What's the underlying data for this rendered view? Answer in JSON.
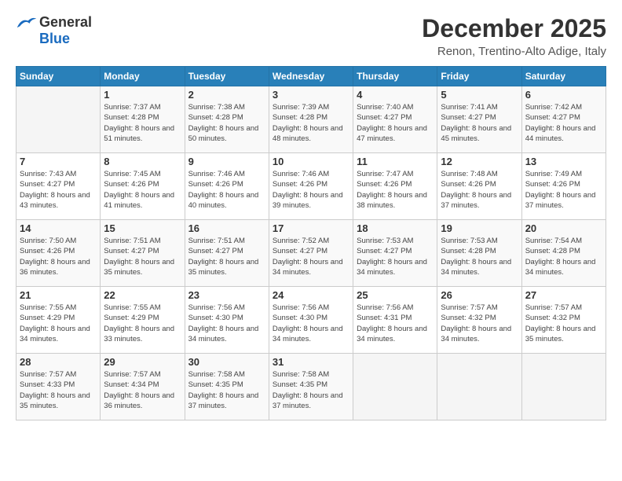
{
  "header": {
    "logo_general": "General",
    "logo_blue": "Blue",
    "title": "December 2025",
    "location": "Renon, Trentino-Alto Adige, Italy"
  },
  "days_of_week": [
    "Sunday",
    "Monday",
    "Tuesday",
    "Wednesday",
    "Thursday",
    "Friday",
    "Saturday"
  ],
  "weeks": [
    [
      {
        "day": "",
        "sunrise": "",
        "sunset": "",
        "daylight": ""
      },
      {
        "day": "1",
        "sunrise": "Sunrise: 7:37 AM",
        "sunset": "Sunset: 4:28 PM",
        "daylight": "Daylight: 8 hours and 51 minutes."
      },
      {
        "day": "2",
        "sunrise": "Sunrise: 7:38 AM",
        "sunset": "Sunset: 4:28 PM",
        "daylight": "Daylight: 8 hours and 50 minutes."
      },
      {
        "day": "3",
        "sunrise": "Sunrise: 7:39 AM",
        "sunset": "Sunset: 4:28 PM",
        "daylight": "Daylight: 8 hours and 48 minutes."
      },
      {
        "day": "4",
        "sunrise": "Sunrise: 7:40 AM",
        "sunset": "Sunset: 4:27 PM",
        "daylight": "Daylight: 8 hours and 47 minutes."
      },
      {
        "day": "5",
        "sunrise": "Sunrise: 7:41 AM",
        "sunset": "Sunset: 4:27 PM",
        "daylight": "Daylight: 8 hours and 45 minutes."
      },
      {
        "day": "6",
        "sunrise": "Sunrise: 7:42 AM",
        "sunset": "Sunset: 4:27 PM",
        "daylight": "Daylight: 8 hours and 44 minutes."
      }
    ],
    [
      {
        "day": "7",
        "sunrise": "Sunrise: 7:43 AM",
        "sunset": "Sunset: 4:27 PM",
        "daylight": "Daylight: 8 hours and 43 minutes."
      },
      {
        "day": "8",
        "sunrise": "Sunrise: 7:45 AM",
        "sunset": "Sunset: 4:26 PM",
        "daylight": "Daylight: 8 hours and 41 minutes."
      },
      {
        "day": "9",
        "sunrise": "Sunrise: 7:46 AM",
        "sunset": "Sunset: 4:26 PM",
        "daylight": "Daylight: 8 hours and 40 minutes."
      },
      {
        "day": "10",
        "sunrise": "Sunrise: 7:46 AM",
        "sunset": "Sunset: 4:26 PM",
        "daylight": "Daylight: 8 hours and 39 minutes."
      },
      {
        "day": "11",
        "sunrise": "Sunrise: 7:47 AM",
        "sunset": "Sunset: 4:26 PM",
        "daylight": "Daylight: 8 hours and 38 minutes."
      },
      {
        "day": "12",
        "sunrise": "Sunrise: 7:48 AM",
        "sunset": "Sunset: 4:26 PM",
        "daylight": "Daylight: 8 hours and 37 minutes."
      },
      {
        "day": "13",
        "sunrise": "Sunrise: 7:49 AM",
        "sunset": "Sunset: 4:26 PM",
        "daylight": "Daylight: 8 hours and 37 minutes."
      }
    ],
    [
      {
        "day": "14",
        "sunrise": "Sunrise: 7:50 AM",
        "sunset": "Sunset: 4:26 PM",
        "daylight": "Daylight: 8 hours and 36 minutes."
      },
      {
        "day": "15",
        "sunrise": "Sunrise: 7:51 AM",
        "sunset": "Sunset: 4:27 PM",
        "daylight": "Daylight: 8 hours and 35 minutes."
      },
      {
        "day": "16",
        "sunrise": "Sunrise: 7:51 AM",
        "sunset": "Sunset: 4:27 PM",
        "daylight": "Daylight: 8 hours and 35 minutes."
      },
      {
        "day": "17",
        "sunrise": "Sunrise: 7:52 AM",
        "sunset": "Sunset: 4:27 PM",
        "daylight": "Daylight: 8 hours and 34 minutes."
      },
      {
        "day": "18",
        "sunrise": "Sunrise: 7:53 AM",
        "sunset": "Sunset: 4:27 PM",
        "daylight": "Daylight: 8 hours and 34 minutes."
      },
      {
        "day": "19",
        "sunrise": "Sunrise: 7:53 AM",
        "sunset": "Sunset: 4:28 PM",
        "daylight": "Daylight: 8 hours and 34 minutes."
      },
      {
        "day": "20",
        "sunrise": "Sunrise: 7:54 AM",
        "sunset": "Sunset: 4:28 PM",
        "daylight": "Daylight: 8 hours and 34 minutes."
      }
    ],
    [
      {
        "day": "21",
        "sunrise": "Sunrise: 7:55 AM",
        "sunset": "Sunset: 4:29 PM",
        "daylight": "Daylight: 8 hours and 34 minutes."
      },
      {
        "day": "22",
        "sunrise": "Sunrise: 7:55 AM",
        "sunset": "Sunset: 4:29 PM",
        "daylight": "Daylight: 8 hours and 33 minutes."
      },
      {
        "day": "23",
        "sunrise": "Sunrise: 7:56 AM",
        "sunset": "Sunset: 4:30 PM",
        "daylight": "Daylight: 8 hours and 34 minutes."
      },
      {
        "day": "24",
        "sunrise": "Sunrise: 7:56 AM",
        "sunset": "Sunset: 4:30 PM",
        "daylight": "Daylight: 8 hours and 34 minutes."
      },
      {
        "day": "25",
        "sunrise": "Sunrise: 7:56 AM",
        "sunset": "Sunset: 4:31 PM",
        "daylight": "Daylight: 8 hours and 34 minutes."
      },
      {
        "day": "26",
        "sunrise": "Sunrise: 7:57 AM",
        "sunset": "Sunset: 4:32 PM",
        "daylight": "Daylight: 8 hours and 34 minutes."
      },
      {
        "day": "27",
        "sunrise": "Sunrise: 7:57 AM",
        "sunset": "Sunset: 4:32 PM",
        "daylight": "Daylight: 8 hours and 35 minutes."
      }
    ],
    [
      {
        "day": "28",
        "sunrise": "Sunrise: 7:57 AM",
        "sunset": "Sunset: 4:33 PM",
        "daylight": "Daylight: 8 hours and 35 minutes."
      },
      {
        "day": "29",
        "sunrise": "Sunrise: 7:57 AM",
        "sunset": "Sunset: 4:34 PM",
        "daylight": "Daylight: 8 hours and 36 minutes."
      },
      {
        "day": "30",
        "sunrise": "Sunrise: 7:58 AM",
        "sunset": "Sunset: 4:35 PM",
        "daylight": "Daylight: 8 hours and 37 minutes."
      },
      {
        "day": "31",
        "sunrise": "Sunrise: 7:58 AM",
        "sunset": "Sunset: 4:35 PM",
        "daylight": "Daylight: 8 hours and 37 minutes."
      },
      {
        "day": "",
        "sunrise": "",
        "sunset": "",
        "daylight": ""
      },
      {
        "day": "",
        "sunrise": "",
        "sunset": "",
        "daylight": ""
      },
      {
        "day": "",
        "sunrise": "",
        "sunset": "",
        "daylight": ""
      }
    ]
  ]
}
